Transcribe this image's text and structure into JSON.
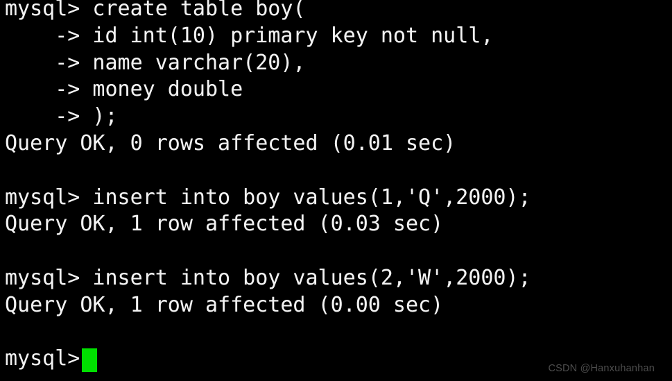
{
  "terminal": {
    "background_color": "#000000",
    "foreground_color": "#f2f2f2",
    "cursor_color": "#00e000",
    "prompt": "mysql> ",
    "continuation_prompt": "    -> ",
    "lines": [
      {
        "id": "line-1",
        "text": "mysql> create table boy("
      },
      {
        "id": "line-2",
        "text": "    -> id int(10) primary key not null,"
      },
      {
        "id": "line-3",
        "text": "    -> name varchar(20),"
      },
      {
        "id": "line-4",
        "text": "    -> money double"
      },
      {
        "id": "line-5",
        "text": "    -> );"
      },
      {
        "id": "line-6",
        "text": "Query OK, 0 rows affected (0.01 sec)"
      },
      {
        "id": "line-7",
        "text": ""
      },
      {
        "id": "line-8",
        "text": "mysql> insert into boy values(1,'Q',2000);"
      },
      {
        "id": "line-9",
        "text": "Query OK, 1 row affected (0.03 sec)"
      },
      {
        "id": "line-10",
        "text": ""
      },
      {
        "id": "line-11",
        "text": "mysql> insert into boy values(2,'W',2000);"
      },
      {
        "id": "line-12",
        "text": "Query OK, 1 row affected (0.00 sec)"
      },
      {
        "id": "line-13",
        "text": ""
      }
    ],
    "active_prompt": "mysql>"
  },
  "watermark": {
    "text": "CSDN @Hanxuhanhan",
    "color": "#4d4d4d"
  }
}
